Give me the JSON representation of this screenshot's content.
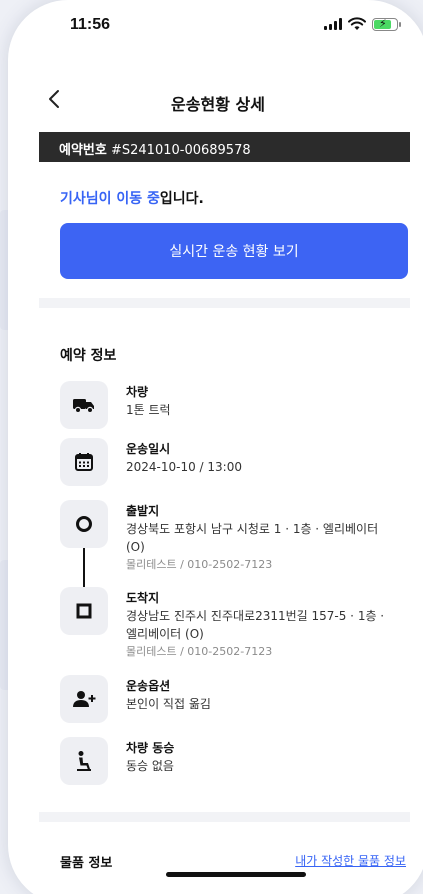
{
  "status": {
    "time": "11:56"
  },
  "header": {
    "title": "운송현황 상세"
  },
  "reservation": {
    "label": "예약번호",
    "number": "#S241010-00689578"
  },
  "driver_status": {
    "highlight": "기사님이 이동 중",
    "suffix": "입니다."
  },
  "live_button": {
    "label": "실시간 운송 현황 보기"
  },
  "reservation_info": {
    "title": "예약 정보",
    "vehicle": {
      "title": "차량",
      "value": "1톤 트럭",
      "icon": "truck-icon"
    },
    "date": {
      "title": "운송일시",
      "value": "2024-10-10 / 13:00",
      "icon": "calendar-icon"
    },
    "origin": {
      "title": "출발지",
      "line1": "경상북도 포항시 남구 시청로 1 · 1층 · 엘리베이터",
      "line2": "(O)",
      "contact": "몰리테스트 / 010-2502-7123",
      "icon": "origin-pin-icon"
    },
    "destination": {
      "title": "도착지",
      "line1": "경상남도 진주시 진주대로2311번길 157-5 · 1층 ·",
      "line2": "엘리베이터 (O)",
      "contact": "몰리테스트 / 010-2502-7123",
      "icon": "destination-square-icon"
    },
    "option": {
      "title": "운송옵션",
      "value": "본인이 직접 옮김",
      "icon": "add-user-icon"
    },
    "ride": {
      "title": "차량 동승",
      "value": "동승 없음",
      "icon": "seated-person-icon"
    }
  },
  "goods_info": {
    "title": "물품 정보",
    "link": "내가 작성한 물품 정보"
  },
  "colors": {
    "accent": "#3d64f3",
    "highlight_text": "#3764f5",
    "bar_bg": "#2b2b2b"
  }
}
